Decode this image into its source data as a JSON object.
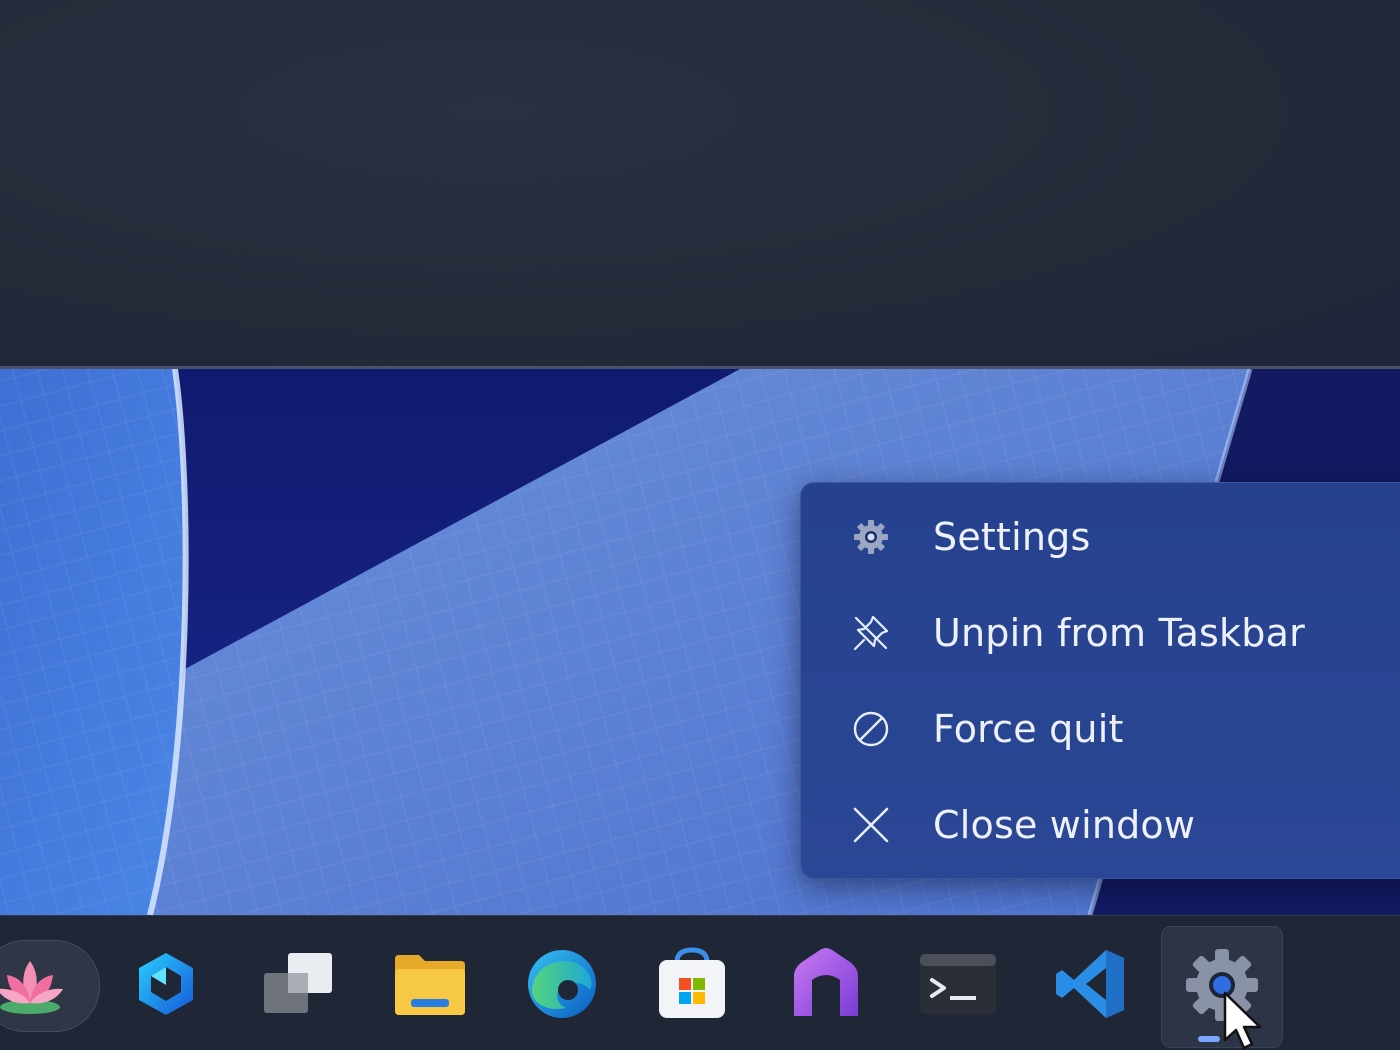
{
  "context_menu": {
    "items": [
      {
        "label": "Settings",
        "icon": "gear-icon"
      },
      {
        "label": "Unpin from Taskbar",
        "icon": "unpin-icon"
      },
      {
        "label": "Force quit",
        "icon": "no-entry-icon"
      },
      {
        "label": "Close window",
        "icon": "close-icon"
      }
    ]
  },
  "taskbar": {
    "apps": [
      {
        "name": "lotus-widget-icon"
      },
      {
        "name": "copilot-icon"
      },
      {
        "name": "task-view-icon"
      },
      {
        "name": "file-explorer-icon"
      },
      {
        "name": "edge-icon"
      },
      {
        "name": "store-icon"
      },
      {
        "name": "home-app-icon"
      },
      {
        "name": "terminal-icon"
      },
      {
        "name": "vscode-icon"
      },
      {
        "name": "settings-app-icon",
        "active": true
      }
    ]
  },
  "colors": {
    "menu_bg": "#26428e",
    "taskbar_bg": "#1f2636",
    "accent": "#7aa7ff"
  }
}
